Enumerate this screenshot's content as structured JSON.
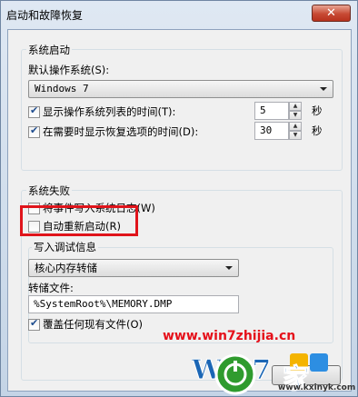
{
  "window": {
    "title": "启动和故障恢复",
    "close_label": "✕"
  },
  "system_startup": {
    "legend": "系统启动",
    "default_os_label": "默认操作系统(S):",
    "default_os_value": "Windows 7",
    "show_os_list": {
      "label": "显示操作系统列表的时间(T):",
      "checked": true,
      "value": "5",
      "unit": "秒"
    },
    "show_recovery": {
      "label": "在需要时显示恢复选项的时间(D):",
      "checked": true,
      "value": "30",
      "unit": "秒"
    }
  },
  "system_failure": {
    "legend": "系统失败",
    "write_event": {
      "label": "将事件写入系统日志(W)",
      "checked": false
    },
    "auto_restart": {
      "label": "自动重新启动(R)",
      "checked": false
    },
    "debug_legend": "写入调试信息",
    "debug_type": "核心内存转储",
    "dump_file_label": "转储文件:",
    "dump_file_value": "%SystemRoot%\\MEMORY.DMP",
    "overwrite": {
      "label": "覆盖任何现有文件(O)",
      "checked": true
    }
  },
  "watermark": {
    "site": "www.win7zhijia.cn",
    "url": "www.kxinyk.com"
  },
  "colors": {
    "highlight": "#e0141b",
    "watermark": "#e5101a"
  }
}
